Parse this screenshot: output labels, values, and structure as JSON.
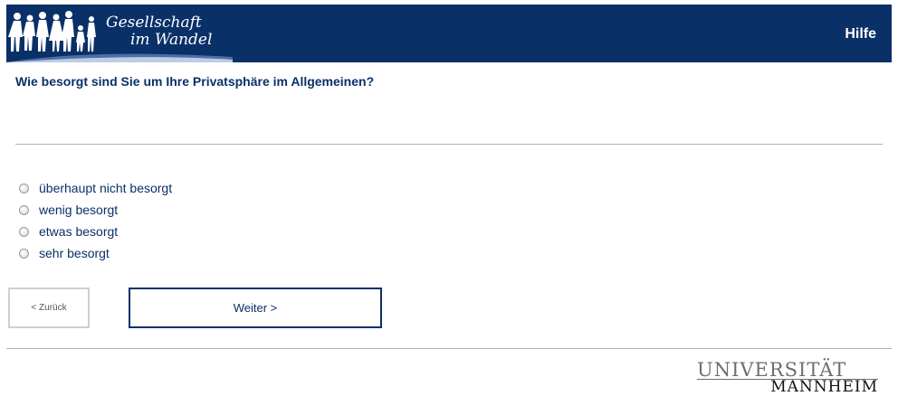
{
  "header": {
    "logo_line1": "Gesellschaft",
    "logo_line2": "im Wandel",
    "help_label": "Hilfe"
  },
  "question": "Wie besorgt sind Sie um Ihre Privatsphäre im Allgemeinen?",
  "options": [
    "überhaupt nicht besorgt",
    "wenig besorgt",
    "etwas besorgt",
    "sehr besorgt"
  ],
  "nav": {
    "back_label": "< Zurück",
    "next_label": "Weiter >"
  },
  "footer": {
    "logo_line1": "UNIVERSITÄT",
    "logo_line2": "MANNHEIM"
  },
  "colors": {
    "brand_navy": "#0a3068",
    "divider": "#b3b3b3"
  }
}
